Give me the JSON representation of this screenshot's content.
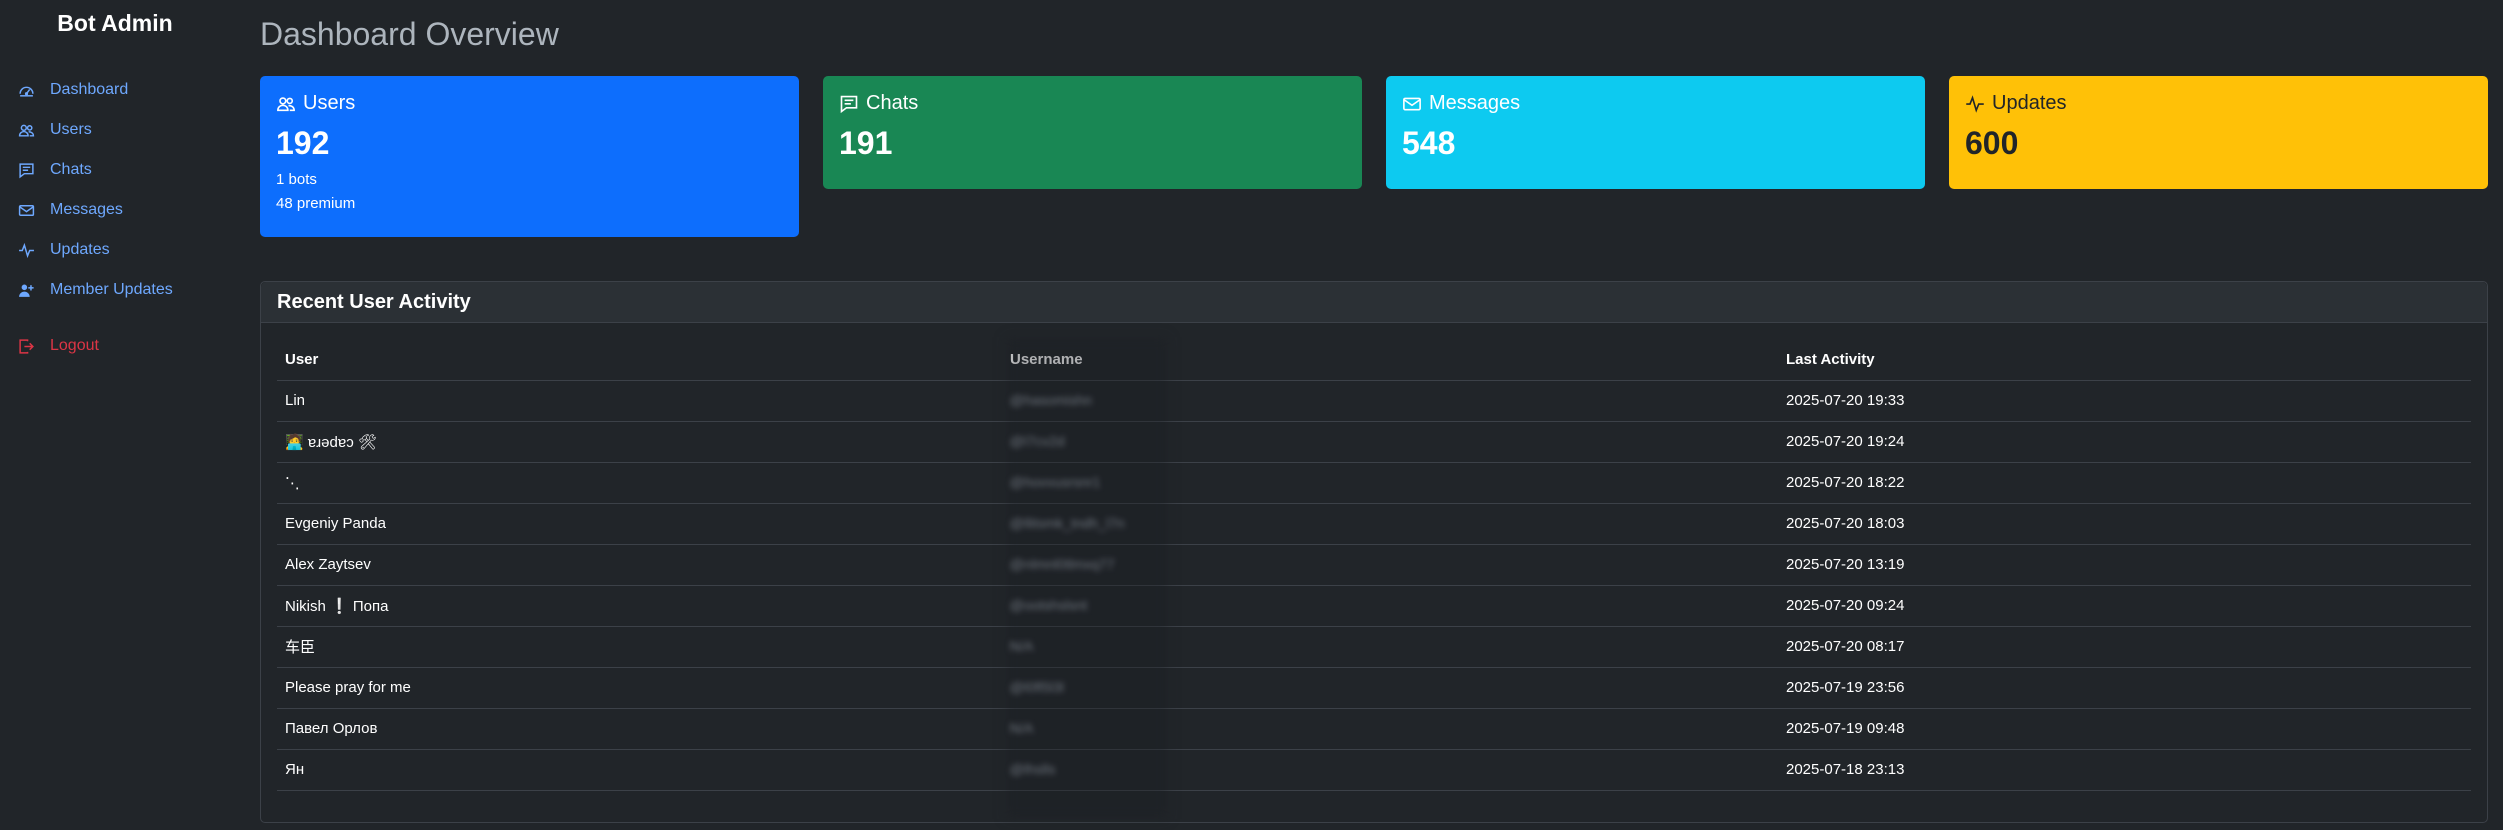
{
  "sidebar": {
    "brand": "Bot Admin",
    "items": [
      {
        "label": "Dashboard",
        "icon": "dashboard-icon"
      },
      {
        "label": "Users",
        "icon": "users-icon"
      },
      {
        "label": "Chats",
        "icon": "chats-icon"
      },
      {
        "label": "Messages",
        "icon": "envelope-icon"
      },
      {
        "label": "Updates",
        "icon": "activity-icon"
      },
      {
        "label": "Member Updates",
        "icon": "user-plus-icon"
      }
    ],
    "logout": {
      "label": "Logout",
      "icon": "logout-icon"
    }
  },
  "page": {
    "title": "Dashboard Overview"
  },
  "cards": {
    "users": {
      "label": "Users",
      "value": "192",
      "sub1": "1 bots",
      "sub2": "48 premium",
      "color": "#0d6efd"
    },
    "chats": {
      "label": "Chats",
      "value": "191",
      "color": "#198754"
    },
    "messages": {
      "label": "Messages",
      "value": "548",
      "color": "#0dcaf0"
    },
    "updates": {
      "label": "Updates",
      "value": "600",
      "color": "#ffc107"
    }
  },
  "activity": {
    "title": "Recent User Activity",
    "columns": [
      "User",
      "Username",
      "Last Activity"
    ],
    "rows": [
      {
        "user": "Lin",
        "username": "@hasomishn",
        "last": "2025-07-20 19:33"
      },
      {
        "user": "🧑‍💻 ɐɹǝdɐɔ 🛠",
        "username": "@l7cv2d",
        "last": "2025-07-20 19:24"
      },
      {
        "user": "⋱",
        "username": "@hovvusrsnr1",
        "last": "2025-07-20 18:22"
      },
      {
        "user": "Evgeniy Panda",
        "username": "@llitsmk_tndh_l7n",
        "last": "2025-07-20 18:03"
      },
      {
        "user": "Alex Zaytsev",
        "username": "@nlmnl0tlmxq77",
        "last": "2025-07-20 13:19"
      },
      {
        "user": "Nikish ❕ Попа",
        "username": "@ootshslsnt",
        "last": "2025-07-20 09:24"
      },
      {
        "user": "车臣",
        "username": "N/A",
        "last": "2025-07-20 08:17"
      },
      {
        "user": "Please pray for me",
        "username": "@l0fl5l3l",
        "last": "2025-07-19 23:56"
      },
      {
        "user": "Павел Орлов",
        "username": "N/A",
        "last": "2025-07-19 09:48"
      },
      {
        "user": "Ян",
        "username": "@lhslls",
        "last": "2025-07-18 23:13"
      }
    ]
  }
}
